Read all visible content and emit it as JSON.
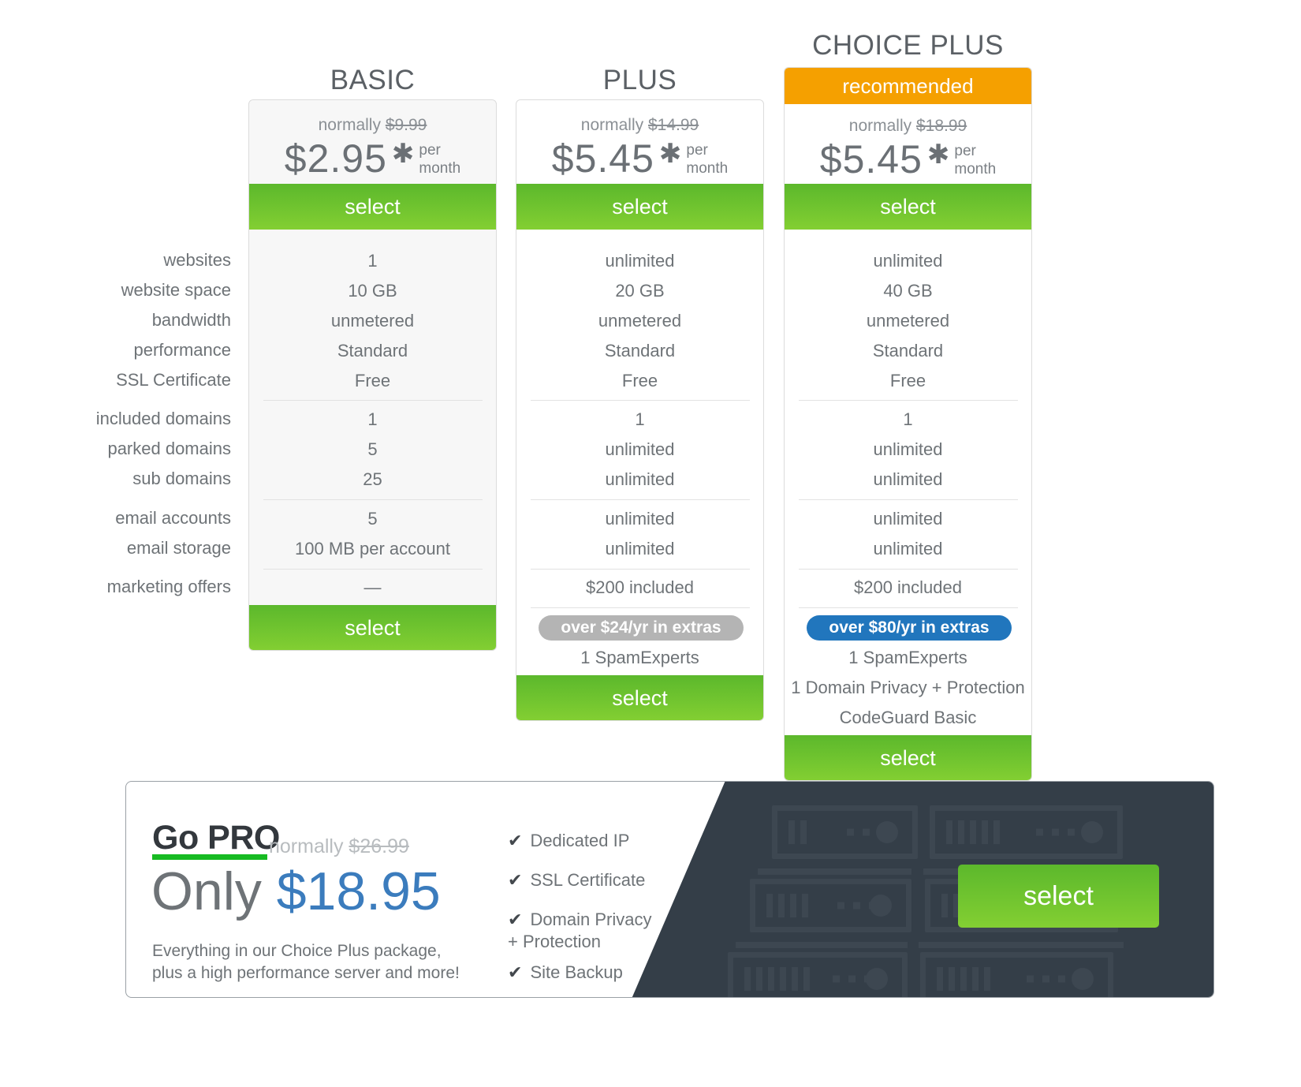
{
  "colors": {
    "green": "#6fbe2f",
    "orange": "#f5a000",
    "blue_pill": "#2176bd",
    "gray_pill": "#b4b4b4",
    "pro_blue": "#3b7cbd",
    "pro_underline": "#17bb22",
    "server_dark": "#343e48"
  },
  "feature_labels": [
    "websites",
    "website space",
    "bandwidth",
    "performance",
    "SSL Certificate",
    "included domains",
    "parked domains",
    "sub domains",
    "email accounts",
    "email storage",
    "marketing offers"
  ],
  "plans": [
    {
      "name": "BASIC",
      "recommended_label": null,
      "normally_prefix": "normally ",
      "normally_price": "$9.99",
      "price": "$2.95",
      "star": "✱",
      "per": "per",
      "month": "month",
      "select_label": "select",
      "select_label_bottom": "select",
      "values": {
        "websites": "1",
        "website_space": "10 GB",
        "bandwidth": "unmetered",
        "performance": "Standard",
        "ssl_certificate": "Free",
        "included_domains": "1",
        "parked_domains": "5",
        "sub_domains": "25",
        "email_accounts": "5",
        "email_storage": "100 MB per account",
        "marketing_offers": "—"
      },
      "extras_pill": null,
      "extras": []
    },
    {
      "name": "PLUS",
      "recommended_label": null,
      "normally_prefix": "normally ",
      "normally_price": "$14.99",
      "price": "$5.45",
      "star": "✱",
      "per": "per",
      "month": "month",
      "select_label": "select",
      "select_label_bottom": "select",
      "values": {
        "websites": "unlimited",
        "website_space": "20 GB",
        "bandwidth": "unmetered",
        "performance": "Standard",
        "ssl_certificate": "Free",
        "included_domains": "1",
        "parked_domains": "unlimited",
        "sub_domains": "unlimited",
        "email_accounts": "unlimited",
        "email_storage": "unlimited",
        "marketing_offers": "$200 included"
      },
      "extras_pill": "over $24/yr in extras",
      "extras": [
        "1 SpamExperts"
      ]
    },
    {
      "name": "CHOICE PLUS",
      "recommended_label": "recommended",
      "normally_prefix": "normally ",
      "normally_price": "$18.99",
      "price": "$5.45",
      "star": "✱",
      "per": "per",
      "month": "month",
      "select_label": "select",
      "select_label_bottom": "select",
      "values": {
        "websites": "unlimited",
        "website_space": "40 GB",
        "bandwidth": "unmetered",
        "performance": "Standard",
        "ssl_certificate": "Free",
        "included_domains": "1",
        "parked_domains": "unlimited",
        "sub_domains": "unlimited",
        "email_accounts": "unlimited",
        "email_storage": "unlimited",
        "marketing_offers": "$200 included"
      },
      "extras_pill": "over $80/yr in extras",
      "extras": [
        "1 SpamExperts",
        "1 Domain Privacy + Protection",
        "CodeGuard Basic"
      ]
    }
  ],
  "pro": {
    "title": "Go PRO",
    "normally_prefix": "normally ",
    "normally_price": "$26.99",
    "only_word": "Only ",
    "amount": "$18.95",
    "desc_line1": "Everything in our Choice Plus package,",
    "desc_line2": "plus a high performance server and more!",
    "features": [
      "Dedicated IP",
      "SSL Certificate",
      "Domain Privacy",
      "+ Protection",
      "Site Backup"
    ],
    "select_label": "select"
  }
}
